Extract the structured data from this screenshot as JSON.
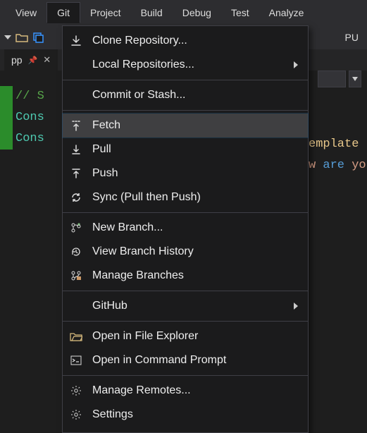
{
  "menubar": {
    "items": [
      "View",
      "Git",
      "Project",
      "Build",
      "Debug",
      "Test",
      "Analyze"
    ],
    "open_index": 1
  },
  "toolbar": {
    "right_label": "PU"
  },
  "tab": {
    "filename": "pp"
  },
  "editor": {
    "lines": [
      {
        "kind": "comment",
        "text": "// S"
      },
      {
        "kind": "cons",
        "text": "Cons"
      },
      {
        "kind": "cons",
        "text": "Cons"
      }
    ],
    "rhs_snippets": {
      "line1": "emplate",
      "line2a": "w ",
      "line2b": "are",
      "line2c": " yo"
    }
  },
  "git_menu": {
    "items": [
      {
        "icon": "download-icon",
        "label": "Clone Repository...",
        "submenu": false
      },
      {
        "icon": "",
        "label": "Local Repositories...",
        "submenu": true
      },
      {
        "separator": true
      },
      {
        "icon": "",
        "label": "Commit or Stash...",
        "submenu": false
      },
      {
        "separator": true
      },
      {
        "icon": "fetch-icon",
        "label": "Fetch",
        "submenu": false,
        "hover": true
      },
      {
        "icon": "pull-icon",
        "label": "Pull",
        "submenu": false
      },
      {
        "icon": "push-icon",
        "label": "Push",
        "submenu": false
      },
      {
        "icon": "sync-icon",
        "label": "Sync (Pull then Push)",
        "submenu": false
      },
      {
        "separator": true
      },
      {
        "icon": "new-branch-icon",
        "label": "New Branch...",
        "submenu": false
      },
      {
        "icon": "history-icon",
        "label": "View Branch History",
        "submenu": false
      },
      {
        "icon": "branches-icon",
        "label": "Manage Branches",
        "submenu": false
      },
      {
        "separator": true
      },
      {
        "icon": "",
        "label": "GitHub",
        "submenu": true
      },
      {
        "separator": true
      },
      {
        "icon": "folder-open-icon",
        "label": "Open in File Explorer",
        "submenu": false
      },
      {
        "icon": "terminal-icon",
        "label": "Open in Command Prompt",
        "submenu": false
      },
      {
        "separator": true
      },
      {
        "icon": "gear-icon",
        "label": "Manage Remotes...",
        "submenu": false
      },
      {
        "icon": "gear-icon",
        "label": "Settings",
        "submenu": false
      }
    ]
  }
}
